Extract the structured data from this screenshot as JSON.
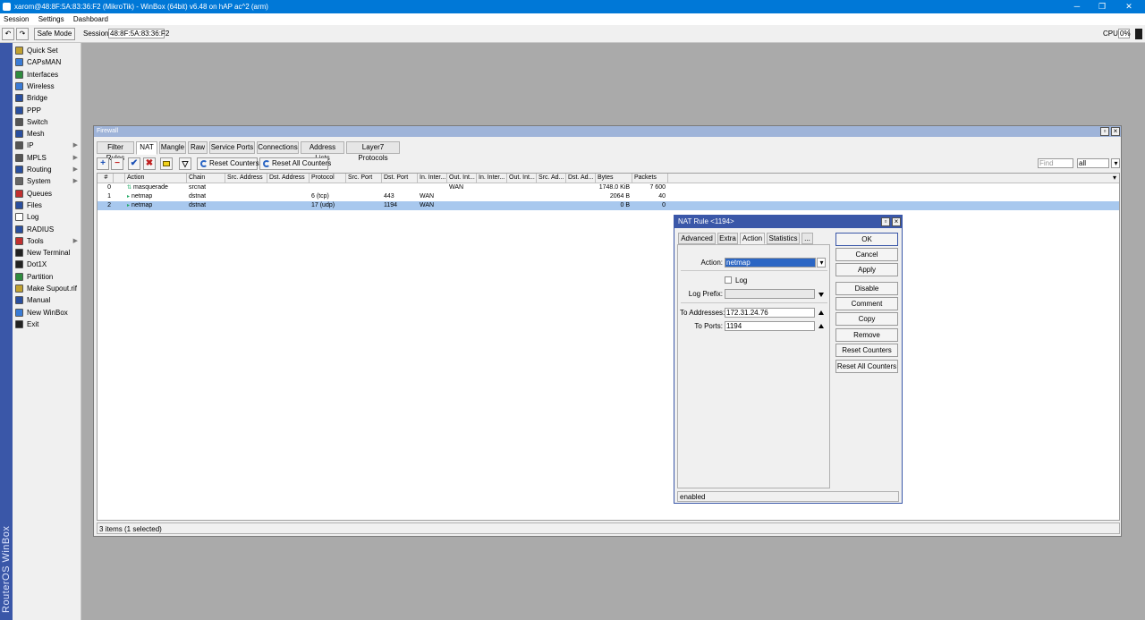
{
  "window": {
    "title": "xarom@48:8F:5A:83:36:F2 (MikroTik) - WinBox (64bit) v6.48 on hAP ac^2 (arm)",
    "min_icon": "minimize-icon",
    "max_icon": "maximize-icon",
    "close_icon": "close-icon"
  },
  "menubar": [
    "Session",
    "Settings",
    "Dashboard"
  ],
  "toolbar": {
    "safe_mode": "Safe Mode",
    "session_label": "Session:",
    "session_value": "48:8F:5A:83:36:F2",
    "cpu_label": "CPU:",
    "cpu_value": "0%"
  },
  "sidebar": {
    "brand": "RouterOS WinBox",
    "items": [
      {
        "label": "Quick Set",
        "icon": "quick-set-icon",
        "color": "#c0a030",
        "arrow": ""
      },
      {
        "label": "CAPsMAN",
        "icon": "capsman-icon",
        "color": "#3a7bd5",
        "arrow": ""
      },
      {
        "label": "Interfaces",
        "icon": "interfaces-icon",
        "color": "#2e8b3e",
        "arrow": ""
      },
      {
        "label": "Wireless",
        "icon": "wireless-icon",
        "color": "#3a7bd5",
        "arrow": ""
      },
      {
        "label": "Bridge",
        "icon": "bridge-icon",
        "color": "#2a4f9e",
        "arrow": ""
      },
      {
        "label": "PPP",
        "icon": "ppp-icon",
        "color": "#2a4f9e",
        "arrow": ""
      },
      {
        "label": "Switch",
        "icon": "switch-icon",
        "color": "#555555",
        "arrow": ""
      },
      {
        "label": "Mesh",
        "icon": "mesh-icon",
        "color": "#2a4f9e",
        "arrow": ""
      },
      {
        "label": "IP",
        "icon": "ip-icon",
        "color": "#555555",
        "arrow": "▶"
      },
      {
        "label": "MPLS",
        "icon": "mpls-icon",
        "color": "#555555",
        "arrow": "▶"
      },
      {
        "label": "Routing",
        "icon": "routing-icon",
        "color": "#2a4f9e",
        "arrow": "▶"
      },
      {
        "label": "System",
        "icon": "system-icon",
        "color": "#666666",
        "arrow": "▶"
      },
      {
        "label": "Queues",
        "icon": "queues-icon",
        "color": "#c03030",
        "arrow": ""
      },
      {
        "label": "Files",
        "icon": "files-icon",
        "color": "#2a4f9e",
        "arrow": ""
      },
      {
        "label": "Log",
        "icon": "log-icon",
        "color": "#ffffff",
        "arrow": ""
      },
      {
        "label": "RADIUS",
        "icon": "radius-icon",
        "color": "#2a4f9e",
        "arrow": ""
      },
      {
        "label": "Tools",
        "icon": "tools-icon",
        "color": "#c03030",
        "arrow": "▶"
      },
      {
        "label": "New Terminal",
        "icon": "terminal-icon",
        "color": "#222222",
        "arrow": ""
      },
      {
        "label": "Dot1X",
        "icon": "dot1x-icon",
        "color": "#222222",
        "arrow": ""
      },
      {
        "label": "Partition",
        "icon": "partition-icon",
        "color": "#2e8b3e",
        "arrow": ""
      },
      {
        "label": "Make Supout.rif",
        "icon": "supout-icon",
        "color": "#c0a030",
        "arrow": ""
      },
      {
        "label": "Manual",
        "icon": "manual-icon",
        "color": "#2a4f9e",
        "arrow": ""
      },
      {
        "label": "New WinBox",
        "icon": "winbox-icon",
        "color": "#3a7bd5",
        "arrow": ""
      },
      {
        "label": "Exit",
        "icon": "exit-icon",
        "color": "#222222",
        "arrow": ""
      }
    ]
  },
  "firewall": {
    "title": "Firewall",
    "tabs": [
      "Filter Rules",
      "NAT",
      "Mangle",
      "Raw",
      "Service Ports",
      "Connections",
      "Address Lists",
      "Layer7 Protocols"
    ],
    "active_tab": "NAT",
    "buttons": {
      "add": "+",
      "remove": "−",
      "enable": "✔",
      "disable": "✖",
      "reset_counters": "Reset Counters",
      "reset_all_counters": "Reset All Counters"
    },
    "find_placeholder": "Find",
    "filter_value": "all",
    "columns": [
      "#",
      "",
      "Action",
      "Chain",
      "Src. Address",
      "Dst. Address",
      "Protocol",
      "Src. Port",
      "Dst. Port",
      "In. Inter...",
      "Out. Int...",
      "In. Inter...",
      "Out. Int...",
      "Src. Ad...",
      "Dst. Ad...",
      "Bytes",
      "Packets"
    ],
    "rows": [
      {
        "num": "0",
        "action": "masquerade",
        "chain": "srcnat",
        "protocol": "",
        "dst_port": "",
        "in_if": "",
        "out_if": "WAN",
        "bytes": "1748.0 KiB",
        "packets": "7 600",
        "selected": false
      },
      {
        "num": "1",
        "action": "netmap",
        "chain": "dstnat",
        "protocol": "6 (tcp)",
        "dst_port": "443",
        "in_if": "WAN",
        "out_if": "",
        "bytes": "2064 B",
        "packets": "40",
        "selected": false
      },
      {
        "num": "2",
        "action": "netmap",
        "chain": "dstnat",
        "protocol": "17 (udp)",
        "dst_port": "1194",
        "in_if": "WAN",
        "out_if": "",
        "bytes": "0 B",
        "packets": "0",
        "selected": true
      }
    ],
    "status": "3 items (1 selected)"
  },
  "nat_rule": {
    "title": "NAT Rule <1194>",
    "tabs": [
      "Advanced",
      "Extra",
      "Action",
      "Statistics",
      "..."
    ],
    "active_tab": "Action",
    "action_label": "Action:",
    "action_value": "netmap",
    "log_label": "Log",
    "log_prefix_label": "Log Prefix:",
    "log_prefix_value": "",
    "to_addresses_label": "To Addresses:",
    "to_addresses_value": "172.31.24.76",
    "to_ports_label": "To Ports:",
    "to_ports_value": "1194",
    "buttons": [
      "OK",
      "Cancel",
      "Apply",
      "Disable",
      "Comment",
      "Copy",
      "Remove",
      "Reset Counters",
      "Reset All Counters"
    ],
    "status": "enabled"
  }
}
